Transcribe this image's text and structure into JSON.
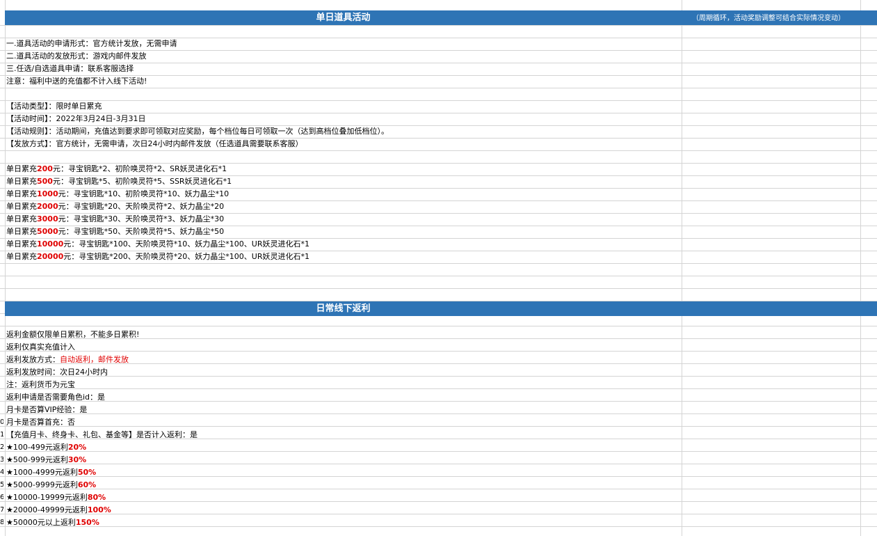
{
  "section1": {
    "title": "单日道具活动",
    "note": "（周期循环，活动奖励调整可结合实际情况变动）",
    "rules": [
      "一.道具活动的申请形式：官方统计发放，无需申请",
      "二.道具活动的发放形式：游戏内邮件发放",
      "三.任选/自选道具申请：联系客服选择",
      "注意：福利中送的充值都不计入线下活动!"
    ],
    "activity": [
      "【活动类型】：限时单日累充",
      "【活动时间】：2022年3月24日-3月31日",
      "【活动规则】：活动期间，充值达到要求即可领取对应奖励，每个档位每日可领取一次（达到高档位叠加低档位）。",
      "【发放方式】：官方统计，无需申请，次日24小时内邮件发放（任选道具需要联系客服）"
    ],
    "tier_prefix": "单日累充",
    "tier_unit": "元",
    "tiers": [
      {
        "amount": "200",
        "rewards": "：寻宝钥匙*2、初阶唤灵符*2、SR妖灵进化石*1"
      },
      {
        "amount": "500",
        "rewards": "：寻宝钥匙*5、初阶唤灵符*5、SSR妖灵进化石*1"
      },
      {
        "amount": "1000",
        "rewards": "：寻宝钥匙*10、初阶唤灵符*10、妖力晶尘*10"
      },
      {
        "amount": "2000",
        "rewards": "：寻宝钥匙*20、天阶唤灵符*2、妖力晶尘*20"
      },
      {
        "amount": "3000",
        "rewards": "：寻宝钥匙*30、天阶唤灵符*3、妖力晶尘*30"
      },
      {
        "amount": "5000",
        "rewards": "：寻宝钥匙*50、天阶唤灵符*5、妖力晶尘*50"
      },
      {
        "amount": "10000",
        "rewards": "：寻宝钥匙*100、天阶唤灵符*10、妖力晶尘*100、UR妖灵进化石*1"
      },
      {
        "amount": "20000",
        "rewards": "：寻宝钥匙*200、天阶唤灵符*20、妖力晶尘*100、UR妖灵进化石*1"
      }
    ]
  },
  "section2": {
    "title": "日常线下返利",
    "rules": [
      "返利金额仅限单日累积，不能多日累积!",
      "返利仅真实充值计入"
    ],
    "dispatch_label": "返利发放方式：",
    "dispatch_value": "自动返利，邮件发放",
    "rules2": [
      "返利发放时间：次日24小时内",
      "注：返利货币为元宝",
      "返利申请是否需要角色id：是",
      "月卡是否算VIP经验：是",
      "月卡是否算首充：否",
      "【充值月卡、终身卡、礼包、基金等】是否计入返利：是"
    ],
    "rebates": [
      {
        "range": "★100-499元返利",
        "pct": "20%"
      },
      {
        "range": "★500-999元返利",
        "pct": "30%"
      },
      {
        "range": "★1000-4999元返利",
        "pct": "50%"
      },
      {
        "range": "★5000-9999元返利",
        "pct": "60%"
      },
      {
        "range": "★10000-19999元返利",
        "pct": "80%"
      },
      {
        "range": "★20000-49999元返利",
        "pct": "100%"
      },
      {
        "range": "★50000元以上返利",
        "pct": "150%"
      }
    ]
  },
  "row_numbers": [
    "0",
    "1",
    "2",
    "3",
    "4",
    "5",
    "6",
    "7",
    "8"
  ],
  "colors": {
    "banner": "#2e74b5",
    "highlight": "#e00000",
    "gridline": "#d4d4d4"
  }
}
